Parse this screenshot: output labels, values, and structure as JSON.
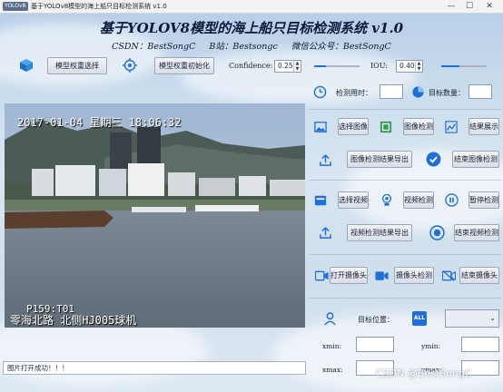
{
  "window": {
    "app_badge": "YOLOv8",
    "title": "基于YOLOv8模型的海上船只目标检测系统 v1.0",
    "minimize": "—",
    "maximize": "☐",
    "close": "✕"
  },
  "header": {
    "title": "基于YOLOV8模型的海上船只目标检测系统 v1.0",
    "csdn": "CSDN：BestSongC",
    "bilibili": "B站：Bestsongc",
    "wechat": "微信公众号：BestSongC"
  },
  "toolbar": {
    "model_select_label": "模型权重选择",
    "model_init_label": "模型权重初始化",
    "confidence_label": "Confidence:",
    "confidence_value": "0.25",
    "confidence_level": 0.25,
    "iou_label": "IOU:",
    "iou_value": "0.40",
    "iou_level": 0.4
  },
  "viewer": {
    "timestamp": "2017-01-04 星期三 18:06:32",
    "caption_line1": "P159:T01",
    "caption_line2": "零海北路 北侧HJ005球机"
  },
  "stats": {
    "time_label": "检测用时：",
    "time_value": "",
    "count_label": "目标数量：",
    "count_value": ""
  },
  "image_section": {
    "select_label": "选择图像",
    "detect_label": "图像检测",
    "show_label": "结果展示",
    "export_label": "图像检测结果导出",
    "finish_label": "结束图像检测"
  },
  "video_section": {
    "select_label": "选择视频",
    "detect_label": "视频检测",
    "pause_label": "暂停检测",
    "export_label": "视频检测结果导出",
    "finish_label": "结束视频检测"
  },
  "camera_section": {
    "open_label": "打开摄像头",
    "detect_label": "摄像头检测",
    "finish_label": "结束摄像头"
  },
  "position": {
    "label": "目标位置：",
    "all_badge": "ALL",
    "select_value": "",
    "xmin_label": "xmin:",
    "xmin_value": "",
    "ymin_label": "ymin:",
    "ymin_value": "",
    "xmax_label": "xmax:",
    "xmax_value": "",
    "ymax_label": "ymax:",
    "ymax_value": ""
  },
  "status": {
    "message": "图片打开成功！！！"
  },
  "watermark": "CSDN @BestSongC",
  "colors": {
    "accent": "#1e6fd9",
    "title_text": "#0a1a3a",
    "panel_bg": "#d5e3f0"
  }
}
